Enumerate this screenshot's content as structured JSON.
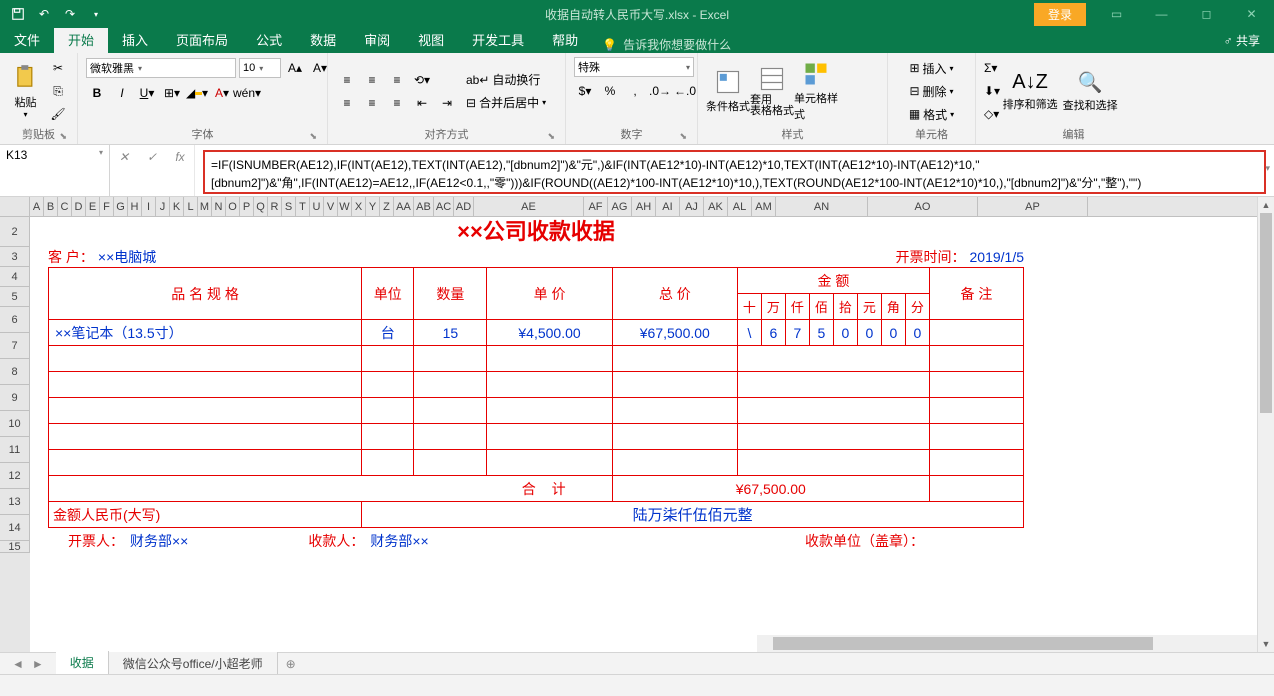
{
  "titlebar": {
    "doc_title": "收据自动转人民币大写.xlsx - Excel",
    "login": "登录"
  },
  "menu": {
    "file": "文件",
    "home": "开始",
    "insert": "插入",
    "layout": "页面布局",
    "formulas": "公式",
    "data": "数据",
    "review": "审阅",
    "view": "视图",
    "developer": "开发工具",
    "help": "帮助",
    "tell_me": "告诉我你想要做什么",
    "share": "共享"
  },
  "ribbon": {
    "clipboard": {
      "label": "剪贴板",
      "paste": "粘贴"
    },
    "font": {
      "label": "字体",
      "name": "微软雅黑",
      "size": "10"
    },
    "align": {
      "label": "对齐方式",
      "wrap": "自动换行",
      "merge": "合并后居中"
    },
    "number": {
      "label": "数字",
      "format": "特殊"
    },
    "styles": {
      "label": "样式",
      "cond": "条件格式",
      "table": "套用\n表格格式",
      "cell": "单元格样式"
    },
    "cells": {
      "label": "单元格",
      "insert": "插入",
      "delete": "删除",
      "format": "格式"
    },
    "editing": {
      "label": "编辑",
      "sort": "排序和筛选",
      "find": "查找和选择"
    }
  },
  "namebox": "K13",
  "formula": "=IF(ISNUMBER(AE12),IF(INT(AE12),TEXT(INT(AE12),\"[dbnum2]\")&\"元\",)&IF(INT(AE12*10)-INT(AE12)*10,TEXT(INT(AE12*10)-INT(AE12)*10,\"[dbnum2]\")&\"角\",IF(INT(AE12)=AE12,,IF(AE12<0.1,,\"零\")))&IF(ROUND((AE12)*100-INT(AE12*10)*10,),TEXT(ROUND(AE12*100-INT(AE12*10)*10,),\"[dbnum2]\")&\"分\",\"整\"),\"\")",
  "col_headers": [
    "A",
    "B",
    "C",
    "D",
    "E",
    "F",
    "G",
    "H",
    "I",
    "J",
    "K",
    "L",
    "M",
    "N",
    "O",
    "P",
    "Q",
    "R",
    "S",
    "T",
    "U",
    "V",
    "W",
    "X",
    "Y",
    "Z",
    "AA",
    "AB",
    "AC",
    "AD",
    "AE",
    "AF",
    "AG",
    "AH",
    "AI",
    "AJ",
    "AK",
    "AL",
    "AM",
    "AN",
    "AO",
    "AP"
  ],
  "row_numbers": [
    "2",
    "3",
    "4",
    "5",
    "6",
    "7",
    "8",
    "9",
    "10",
    "11",
    "12",
    "13",
    "14",
    "15"
  ],
  "receipt": {
    "title": "××公司收款收据",
    "customer_label": "客 户：",
    "customer": "××电脑城",
    "date_label": "开票时间：",
    "date": "2019/1/5",
    "h_spec": "品 名 规 格",
    "h_unit": "单位",
    "h_qty": "数量",
    "h_price": "单  价",
    "h_total": "总  价",
    "h_amount": "金    额",
    "h_note": "备 注",
    "dig_labels": [
      "十",
      "万",
      "仟",
      "佰",
      "拾",
      "元",
      "角",
      "分"
    ],
    "item_name": "××笔记本（13.5寸）",
    "item_unit": "台",
    "item_qty": "15",
    "item_price": "¥4,500.00",
    "item_total": "¥67,500.00",
    "item_digits": [
      "\\",
      "6",
      "7",
      "5",
      "0",
      "0",
      "0",
      "0"
    ],
    "sum_label": "合      计",
    "sum_value": "¥67,500.00",
    "amt_cn_label": "金额人民币(大写)",
    "amt_cn": "陆万柒仟伍佰元整",
    "f_issuer_k": "开票人：",
    "f_issuer_v": "财务部××",
    "f_payee_k": "收款人：",
    "f_payee_v": "财务部××",
    "f_stamp_k": "收款单位（盖章）："
  },
  "sheets": {
    "tab1": "收据",
    "tab2": "微信公众号office/小超老师"
  },
  "chart_data": {
    "type": "table",
    "title": "××公司收款收据",
    "columns": [
      "品名规格",
      "单位",
      "数量",
      "单价",
      "总价"
    ],
    "rows": [
      [
        "××笔记本（13.5寸）",
        "台",
        15,
        4500.0,
        67500.0
      ]
    ],
    "total": 67500.0,
    "amount_cn": "陆万柒仟伍佰元整",
    "currency": "CNY"
  }
}
